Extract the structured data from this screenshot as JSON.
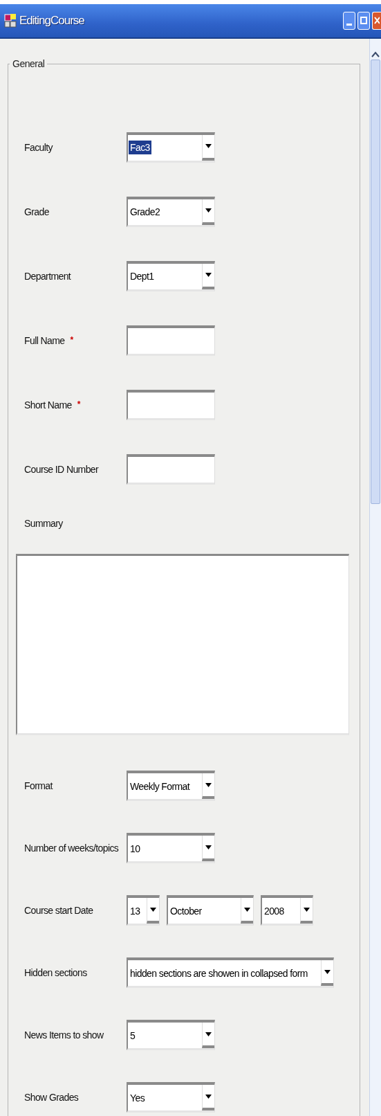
{
  "window": {
    "title": "EditingCourse"
  },
  "group": {
    "title": "General"
  },
  "fields": [
    {
      "kind": "select",
      "label": "Faculty",
      "value": "Fac3",
      "highlighted": true
    },
    {
      "kind": "select",
      "label": "Grade",
      "value": "Grade2",
      "highlighted": false
    },
    {
      "kind": "select",
      "label": "Department",
      "value": "Dept1",
      "highlighted": false
    },
    {
      "kind": "text",
      "label": "Full Name",
      "required_mark": "*"
    },
    {
      "kind": "text",
      "label": "Short Name",
      "required_mark": "*"
    },
    {
      "kind": "text",
      "label": "Course ID Number"
    },
    {
      "kind": "textarea",
      "label": "Summary"
    },
    {
      "kind": "select",
      "label": "Format",
      "value": "Weekly Format",
      "highlighted": false
    },
    {
      "kind": "select",
      "label": "Number of weeks/topics",
      "value": "10",
      "highlighted": false
    },
    {
      "kind": "date",
      "label": "Course start Date",
      "day": "13",
      "month": "October",
      "year": "2008"
    },
    {
      "kind": "wide_select",
      "label": "Hidden sections",
      "value": "hidden sections are showen in collapsed form",
      "highlighted": false
    },
    {
      "kind": "select",
      "label": "News Items to show",
      "value": "5",
      "highlighted": false
    },
    {
      "kind": "select",
      "label": "Show Grades",
      "value": "Yes",
      "highlighted": false
    }
  ]
}
